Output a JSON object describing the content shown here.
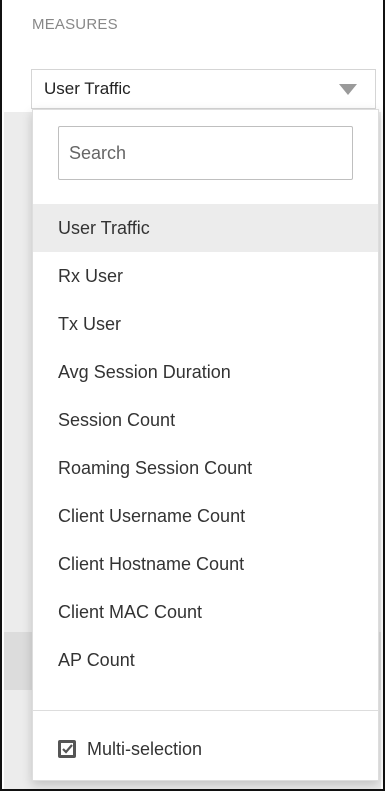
{
  "section": {
    "label": "MEASURES"
  },
  "select": {
    "value": "User Traffic"
  },
  "search": {
    "placeholder": "Search"
  },
  "options": [
    "User Traffic",
    "Rx User",
    "Tx User",
    "Avg Session Duration",
    "Session Count",
    "Roaming Session Count",
    "Client Username Count",
    "Client Hostname Count",
    "Client MAC Count",
    "AP Count"
  ],
  "selected_option": "User Traffic",
  "multi_selection": {
    "label": "Multi-selection",
    "checked": true
  },
  "colors": {
    "selected_bg": "#ececec",
    "text": "#333333",
    "label": "#888888"
  }
}
